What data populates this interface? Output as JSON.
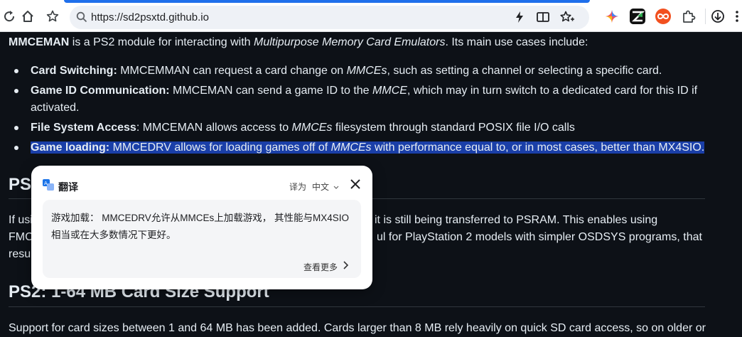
{
  "browser": {
    "url": "https://sd2psxtd.github.io"
  },
  "page": {
    "intro_bold": "MMCEMAN",
    "intro_text1": " is a PS2 module for interacting with ",
    "intro_italic": "Multipurpose Memory Card Emulators",
    "intro_text2": ". Its main use cases include:",
    "bullets": [
      {
        "bold": "Card Switching:",
        "text1": " MMCEMMAN can request a card change on ",
        "italic": "MMCEs",
        "text2": ", such as setting a channel or selecting a specific card."
      },
      {
        "bold": "Game ID Communication:",
        "text1": " MMCEMAN can send a game ID to the ",
        "italic": "MMCE",
        "text2": ", which may in turn switch to a dedicated card for this ID if",
        "text3": "activated."
      },
      {
        "bold": "File System Access",
        "text1": ": MMCEMAN allows access to ",
        "italic": "MMCEs",
        "text2": " filesystem through standard POSIX file I/O calls"
      },
      {
        "bold": "Game loading:",
        "text1": " MMCEDRV allows for loading games off of ",
        "italic": "MMCEs",
        "text2": " with performance equal to, or in most cases, better than MX4SIO."
      }
    ],
    "heading_partial": "PS2",
    "para_line1_left": "If usi",
    "para_line1_right": "it is still being transferred to PSRAM. This enables using",
    "para_line2_left": "FMC",
    "para_line2_right": "ul for PlayStation 2 models with simpler OSDSYS programs, that",
    "para_line3_left": "resul",
    "heading2": "PS2: 1-64 MB Card Size Support",
    "para2": "Support for card sizes between 1 and 64 MB has been added. Cards larger than 8 MB rely heavily on quick SD card access, so on older or"
  },
  "translate_popup": {
    "title": "翻译",
    "lang_label": "译为",
    "lang_value": "中文",
    "result": "游戏加载： MMCEDRV允许从MMCEs上加载游戏， 其性能与MX4SIO相当或在大多数情况下更好。",
    "more": "查看更多"
  },
  "colors": {
    "page_bg": "#0d1117",
    "highlight": "#1a3fa8",
    "toolbar_bg": "#ffffff"
  }
}
